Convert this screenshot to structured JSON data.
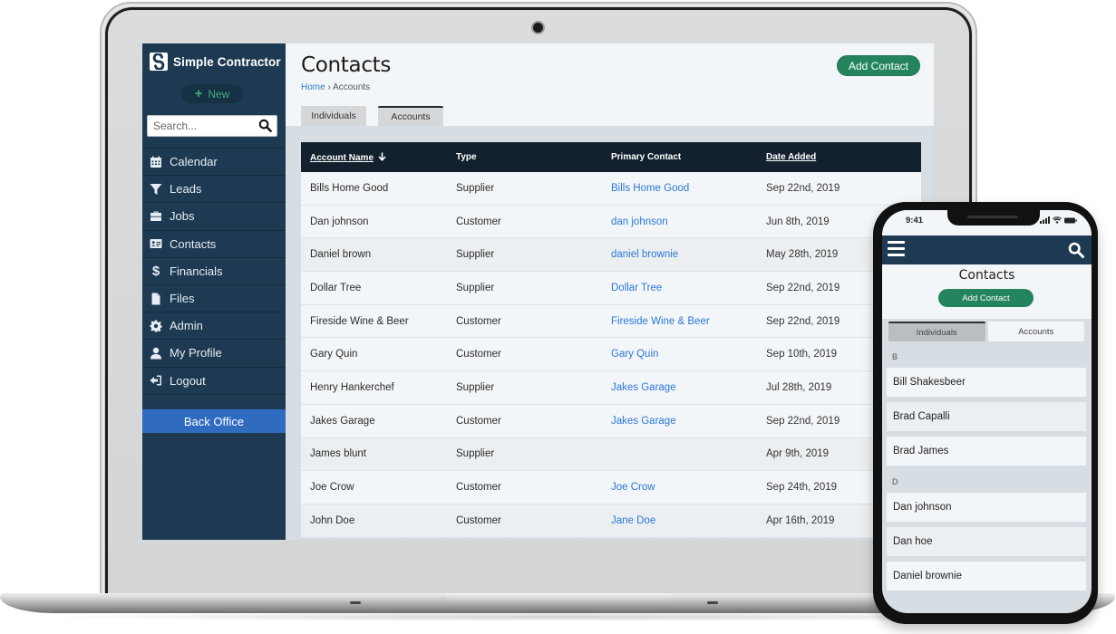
{
  "app": {
    "brand_name": "Simple Contractor",
    "brand_logo_glyph": "S",
    "colors": {
      "sidebar": "#1e3a52",
      "accent_green": "#23845d",
      "link_blue": "#2a78d8",
      "back_office_blue": "#2f6bbf",
      "table_header": "#12212d"
    }
  },
  "sidebar": {
    "new_label": "New",
    "new_icon": "plus-icon",
    "search_placeholder": "Search...",
    "search_icon": "search-icon",
    "items": [
      {
        "label": "Calendar",
        "icon": "calendar-icon"
      },
      {
        "label": "Leads",
        "icon": "filter-icon"
      },
      {
        "label": "Jobs",
        "icon": "briefcase-icon"
      },
      {
        "label": "Contacts",
        "icon": "address-card-icon"
      },
      {
        "label": "Financials",
        "icon": "dollar-icon"
      },
      {
        "label": "Files",
        "icon": "file-icon"
      },
      {
        "label": "Admin",
        "icon": "gear-icon"
      },
      {
        "label": "My Profile",
        "icon": "user-icon"
      },
      {
        "label": "Logout",
        "icon": "logout-icon"
      }
    ],
    "back_office_label": "Back Office"
  },
  "main": {
    "title": "Contacts",
    "breadcrumb": {
      "home": "Home",
      "separator": "›",
      "current": "Accounts"
    },
    "add_contact_label": "Add Contact",
    "tabs": [
      {
        "label": "Individuals",
        "active": false
      },
      {
        "label": "Accounts",
        "active": true
      }
    ],
    "table": {
      "columns": [
        {
          "label": "Account Name",
          "sortable": true,
          "sort": "descending",
          "sort_icon": "arrow-down-icon"
        },
        {
          "label": "Type",
          "sortable": false
        },
        {
          "label": "Primary Contact",
          "sortable": false
        },
        {
          "label": "Date Added",
          "sortable": true
        }
      ],
      "rows": [
        {
          "name": "Bills Home Good",
          "type": "Supplier",
          "contact": "Bills Home Good",
          "date": "Sep 22nd, 2019"
        },
        {
          "name": "Dan johnson",
          "type": "Customer",
          "contact": "dan johnson",
          "date": "Jun 8th, 2019"
        },
        {
          "name": "Daniel brown",
          "type": "Supplier",
          "contact": "daniel brownie",
          "date": "May 28th, 2019"
        },
        {
          "name": "Dollar Tree",
          "type": "Supplier",
          "contact": "Dollar Tree",
          "date": "Sep 22nd, 2019"
        },
        {
          "name": "Fireside Wine & Beer",
          "type": "Customer",
          "contact": "Fireside Wine & Beer",
          "date": "Sep 22nd, 2019"
        },
        {
          "name": "Gary Quin",
          "type": "Customer",
          "contact": "Gary Quin",
          "date": "Sep 10th, 2019"
        },
        {
          "name": "Henry Hankerchef",
          "type": "Supplier",
          "contact": "Jakes Garage",
          "date": "Jul 28th, 2019"
        },
        {
          "name": "Jakes Garage",
          "type": "Customer",
          "contact": "Jakes Garage",
          "date": "Sep 22nd, 2019"
        },
        {
          "name": "James blunt",
          "type": "Supplier",
          "contact": "",
          "date": "Apr 9th, 2019"
        },
        {
          "name": "Joe Crow",
          "type": "Customer",
          "contact": "Joe Crow",
          "date": "Sep 24th, 2019"
        },
        {
          "name": "John Doe",
          "type": "Customer",
          "contact": "Jane Doe",
          "date": "Apr 16th, 2019"
        }
      ]
    }
  },
  "mobile": {
    "time": "9:41",
    "menu_icon": "hamburger-icon",
    "search_icon": "search-icon",
    "title": "Contacts",
    "add_contact_label": "Add Contact",
    "tabs": [
      {
        "label": "Individuals",
        "active": true
      },
      {
        "label": "Accounts",
        "active": false
      }
    ],
    "sections": [
      {
        "letter": "B",
        "items": [
          "Bill Shakesbeer",
          "Brad Capalli",
          "Brad James"
        ]
      },
      {
        "letter": "D",
        "items": [
          "Dan johnson",
          "Dan hoe",
          "Daniel brownie"
        ]
      }
    ]
  }
}
